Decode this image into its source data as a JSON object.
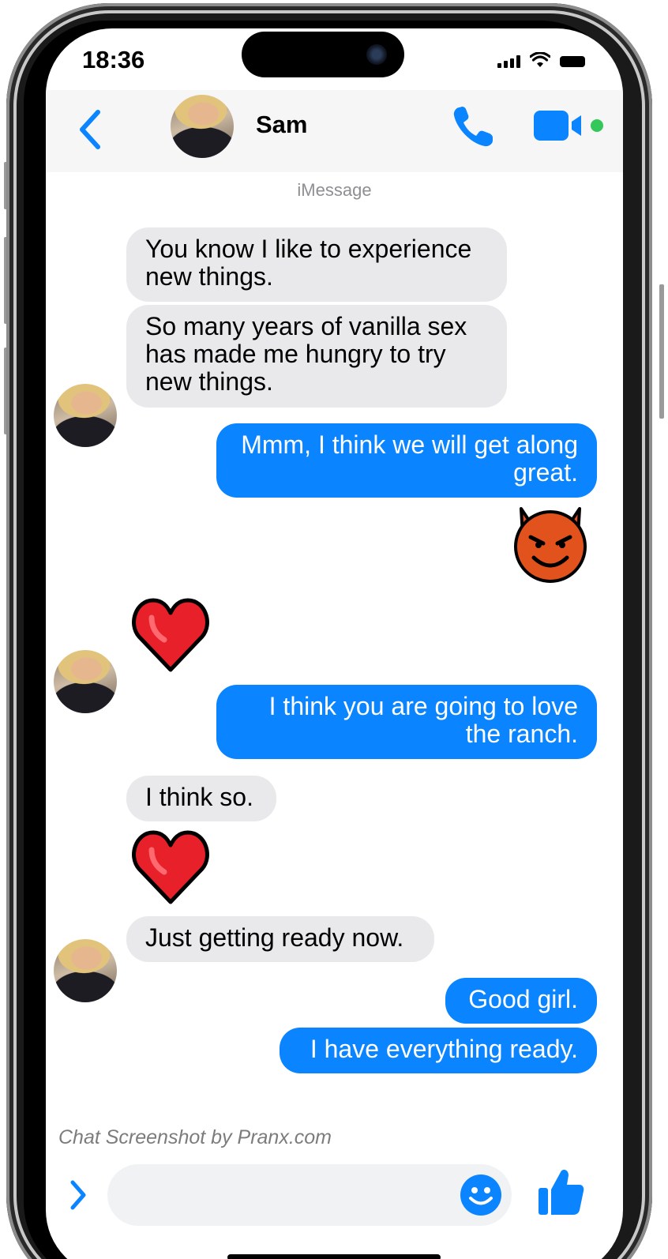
{
  "status_bar": {
    "time": "18:36"
  },
  "header": {
    "contact_name": "Sam"
  },
  "thread": {
    "service_label": "iMessage",
    "messages": [
      {
        "from": "them",
        "text": "You know I like to experience new things."
      },
      {
        "from": "them",
        "text": "So many years of vanilla sex has made me hungry to try new things."
      },
      {
        "from": "me",
        "text": "Mmm, I think we will get along great."
      },
      {
        "from": "me",
        "emoji": "smiling-devil"
      },
      {
        "from": "them",
        "emoji": "red-heart"
      },
      {
        "from": "me",
        "text": "I think you are going to love the ranch."
      },
      {
        "from": "them",
        "text": "I think so."
      },
      {
        "from": "them",
        "emoji": "red-heart"
      },
      {
        "from": "them",
        "text": "Just getting ready now."
      },
      {
        "from": "me",
        "text": "Good girl."
      },
      {
        "from": "me",
        "text": "I have everything ready."
      }
    ]
  },
  "watermark": "Chat Screenshot by Pranx.com",
  "composer": {
    "input_value": "",
    "placeholder": ""
  },
  "colors": {
    "accent": "#0a84ff",
    "incoming_bubble": "#e9e9eb",
    "video_online_dot": "#34c759"
  }
}
